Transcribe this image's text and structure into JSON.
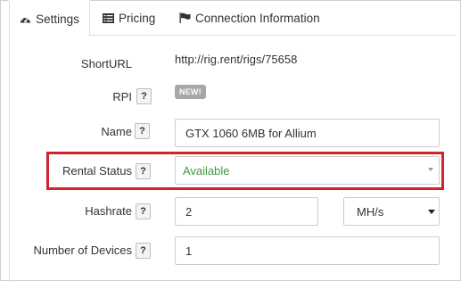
{
  "tabs": [
    {
      "label": "Settings",
      "icon": "dashboard-icon",
      "active": true
    },
    {
      "label": "Pricing",
      "icon": "list-icon",
      "active": false
    },
    {
      "label": "Connection Information",
      "icon": "flag-icon",
      "active": false
    }
  ],
  "help_glyph": "?",
  "fields": {
    "shorturl": {
      "label": "ShortURL",
      "value": "http://rig.rent/rigs/75658"
    },
    "rpi": {
      "label": "RPI",
      "badge": "NEW!"
    },
    "name": {
      "label": "Name",
      "value": "GTX 1060 6MB for Allium"
    },
    "rental_status": {
      "label": "Rental Status",
      "value": "Available"
    },
    "hashrate": {
      "label": "Hashrate",
      "value": "2",
      "unit": "MH/s"
    },
    "devices": {
      "label": "Number of Devices",
      "value": "1"
    }
  },
  "colors": {
    "highlight": "#d0232b",
    "available_text": "#3c9a3c",
    "badge_bg": "#a7a7a7"
  }
}
